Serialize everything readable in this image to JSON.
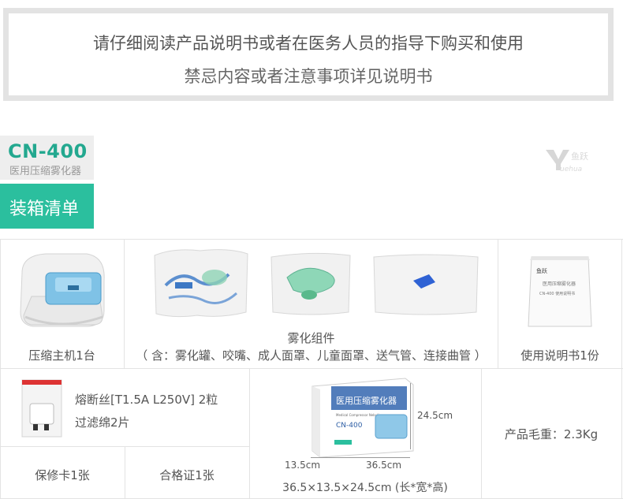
{
  "notice": {
    "line1": "请仔细阅读产品说明书或者在医务人员的指导下购买和使用",
    "line2": "禁忌内容或者注意事项详见说明书"
  },
  "product": {
    "model": "CN-400",
    "name": "医用压缩雾化器"
  },
  "section_title": "装箱清单",
  "items": {
    "main_unit": "压缩主机1台",
    "kit_title": "雾化组件",
    "kit_contents": "（ 含：雾化罐、咬嘴、成人面罩、儿童面罩、送气管、连接曲管 ）",
    "manual": "使用说明书1份",
    "fuse_line1": "熔断丝[T1.5A L250V] 2粒",
    "fuse_line2": "过滤绵2片",
    "warranty": "保修卡1张",
    "certificate": "合格证1张",
    "box_height": "24.5cm",
    "box_depth": "13.5cm",
    "box_width": "36.5cm",
    "box_dims": "36.5×13.5×24.5cm (长*宽*高)",
    "gross_weight": "产品毛重：2.3Kg"
  },
  "box_print": {
    "title": "医用压缩雾化器",
    "subtitle": "Medical Compressor Nebulizer",
    "model": "CN-400"
  },
  "colors": {
    "accent": "#2bbf9e",
    "model_text": "#23a88f",
    "border": "#e3e3e3"
  }
}
